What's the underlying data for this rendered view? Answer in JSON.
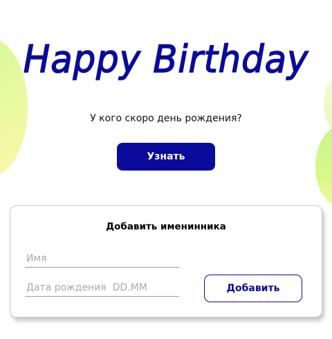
{
  "header": {
    "title": "Happy Birthday",
    "question": "У кого скоро день рождения?",
    "find_button_label": "Узнать"
  },
  "add_card": {
    "title": "Добавить именинника",
    "name_placeholder": "Имя",
    "date_placeholder": "Дата рождения  DD.MM",
    "add_button_label": "Добавить"
  },
  "colors": {
    "accent": "#0a0a9b",
    "blob_green": "#d7f79a",
    "blob_yellow": "#fbf7a8"
  }
}
